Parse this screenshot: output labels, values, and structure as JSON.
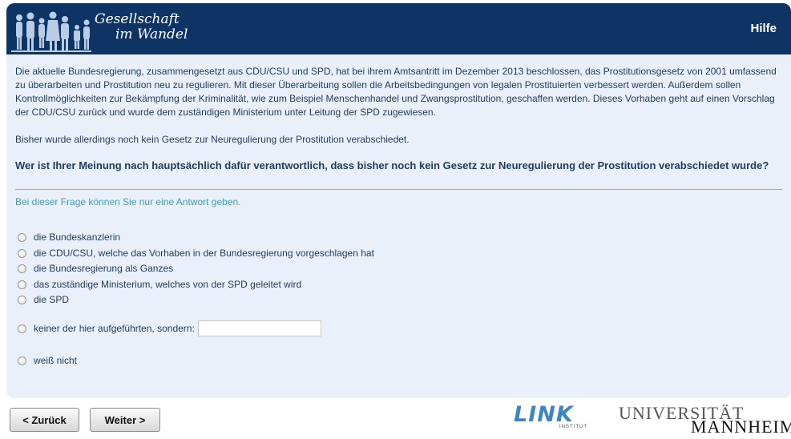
{
  "header": {
    "logo_line1": "Gesellschaft",
    "logo_line2": "im Wandel",
    "help_label": "Hilfe",
    "color": "#0d3464"
  },
  "intro": {
    "paragraph1": "Die aktuelle Bundesregierung, zusammengesetzt aus CDU/CSU und SPD, hat bei ihrem Amtsantritt im Dezember 2013 beschlossen, das Prostitutionsgesetz von 2001 umfassend zu überarbeiten und Prostitution neu zu regulieren. Mit dieser Überarbeitung sollen die Arbeitsbedingungen von legalen Prostituierten verbessert werden. Außerdem sollen Kontrollmöglichkeiten zur Bekämpfung der Kriminalität, wie zum Beispiel Menschenhandel und Zwangsprostitution, geschaffen werden. Dieses Vorhaben geht auf einen Vorschlag der CDU/CSU zurück und wurde dem zuständigen Ministerium unter Leitung der SPD zugewiesen.",
    "paragraph2": "Bisher wurde allerdings noch kein Gesetz zur Neuregulierung der Prostitution verabschiedet."
  },
  "question": {
    "text": "Wer ist Ihrer Meinung nach hauptsächlich dafür verantwortlich, dass bisher noch kein Gesetz zur Neuregulierung der Prostitution verabschiedet wurde?",
    "hint": "Bei dieser Frage können Sie nur eine Antwort geben."
  },
  "options": [
    "die Bundeskanzlerin",
    "die CDU/CSU, welche das Vorhaben in der Bundesregierung vorgeschlagen hat",
    "die Bundesregierung als Ganzes",
    "das zuständige Ministerium, welches von der SPD geleitet wird",
    "die SPD",
    "keiner der hier aufgeführten, sondern:",
    "weiß nicht"
  ],
  "other_input_value": "",
  "nav": {
    "back_label": "< Zurück",
    "next_label": "Weiter >"
  },
  "logos": {
    "link_word": "LINK",
    "link_sub": "INSTITUT",
    "uni_top": "UNIVERSITÄT",
    "uni_bottom": "MANNHEIM"
  }
}
